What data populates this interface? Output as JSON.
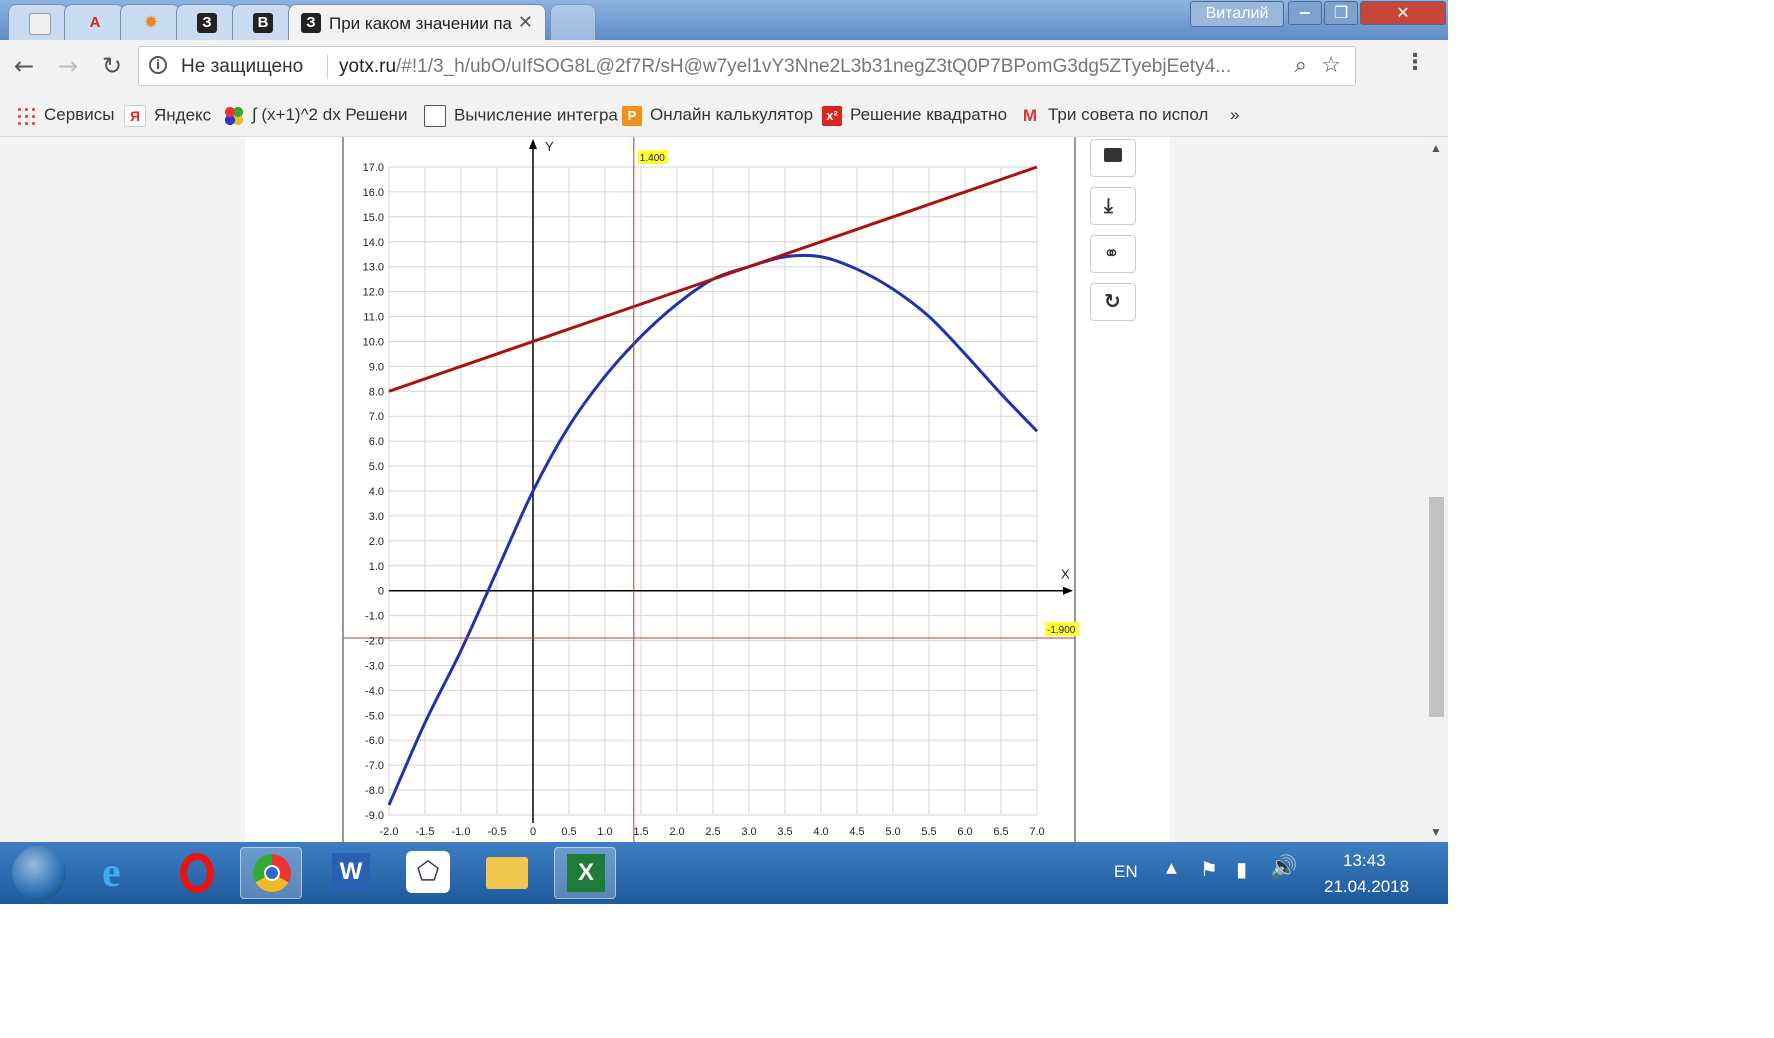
{
  "browser": {
    "tabs": [
      {
        "title": "",
        "icon": "blank-page-icon"
      },
      {
        "title": "",
        "icon": "app-a-icon"
      },
      {
        "title": "",
        "icon": "gear-orange-icon"
      },
      {
        "title": "",
        "icon": "z-icon"
      },
      {
        "title": "",
        "icon": "v-icon"
      },
      {
        "title": "При каком значении па",
        "icon": "z-icon",
        "active": true
      }
    ],
    "user": "Виталий",
    "security_label": "Не защищено",
    "url_host": "yotx.ru",
    "url_path": "/#!1/3_h/ubO/uIfSOG8L@2f7R/sH@w7yel1vY3Nne2L3b31negZ3tQ0P7BPomG3dg5ZTyebjEety4..."
  },
  "bookmarks": [
    {
      "label": "Сервисы",
      "icon": "apps-grid-icon"
    },
    {
      "label": "Яндекс",
      "icon": "yandex-icon"
    },
    {
      "label": "∫ (x+1)^2 dx Решени",
      "icon": "colored-dots-icon"
    },
    {
      "label": "Вычисление интегра",
      "icon": "doc-icon"
    },
    {
      "label": "Онлайн калькулятор",
      "icon": "orange-p-icon"
    },
    {
      "label": "Решение квадратно",
      "icon": "red-x-icon"
    },
    {
      "label": "Три совета по испол",
      "icon": "gmail-icon"
    },
    {
      "label": "»",
      "icon": ""
    }
  ],
  "chart_data": {
    "type": "line",
    "xlabel": "X",
    "ylabel": "Y",
    "xlim": [
      -2.0,
      7.0
    ],
    "ylim": [
      -9.0,
      17.0
    ],
    "x_ticks": [
      "-2.0",
      "-1.5",
      "-1.0",
      "-0.5",
      "0",
      "0.5",
      "1.0",
      "1.5",
      "2.0",
      "2.5",
      "3.0",
      "3.5",
      "4.0",
      "4.5",
      "5.0",
      "5.5",
      "6.0",
      "6.5",
      "7.0"
    ],
    "y_ticks": [
      "17.0",
      "16.0",
      "15.0",
      "14.0",
      "13.0",
      "12.0",
      "11.0",
      "10.0",
      "9.0",
      "8.0",
      "7.0",
      "6.0",
      "5.0",
      "4.0",
      "3.0",
      "2.0",
      "1.0",
      "0",
      "-1.0",
      "-2.0",
      "-3.0",
      "-4.0",
      "-5.0",
      "-6.0",
      "-7.0",
      "-8.0",
      "-9.0"
    ],
    "grid": true,
    "series": [
      {
        "color": "#2233aa",
        "x": [
          -2.0,
          -1.5,
          -1.0,
          -0.5,
          0,
          0.5,
          1.0,
          1.5,
          2.0,
          2.5,
          3.0,
          3.5,
          4.0,
          4.5,
          5.0,
          5.5,
          6.0,
          6.5,
          7.0
        ],
        "y": [
          -8.6,
          -5.3,
          -2.4,
          0.8,
          4.0,
          6.6,
          8.6,
          10.2,
          11.5,
          12.5,
          13.0,
          13.4,
          13.4,
          12.9,
          12.1,
          11.0,
          9.5,
          7.9,
          6.4
        ]
      },
      {
        "color": "#aa1111",
        "x": [
          -2.0,
          7.0
        ],
        "y": [
          8.0,
          17.0
        ]
      }
    ],
    "crosshair": {
      "x": 1.4,
      "y": -1.9,
      "x_label": "1.400",
      "y_label": "-1.900"
    }
  },
  "taskbar": {
    "lang": "EN",
    "time": "13:43",
    "date": "21.04.2018"
  }
}
